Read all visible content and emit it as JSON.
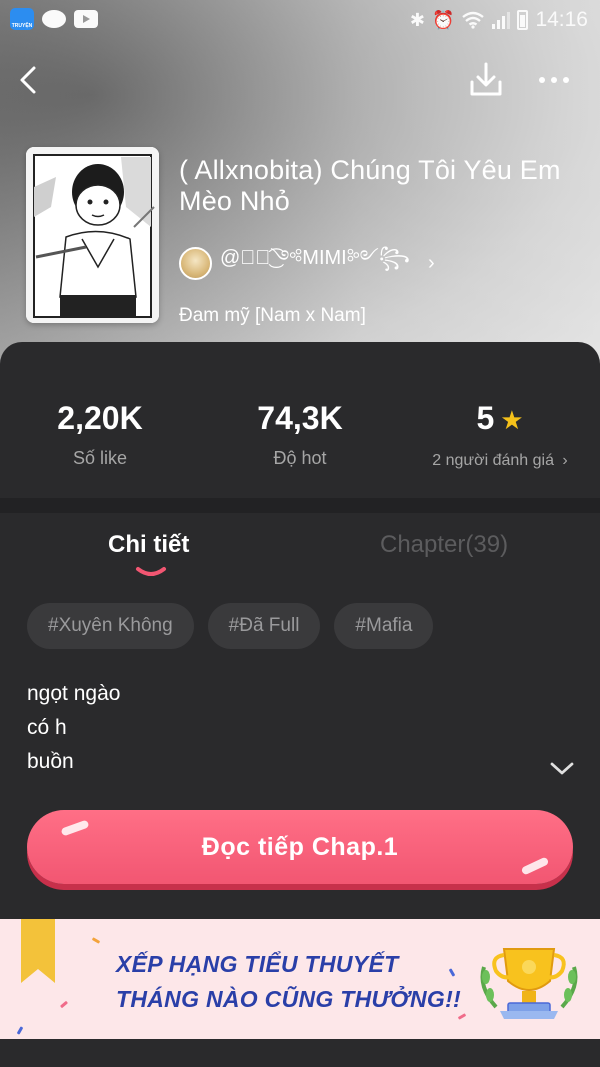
{
  "status_bar": {
    "time": "14:16",
    "app_icon_text": "TRUYỆN"
  },
  "story": {
    "title": "( Allxnobita) Chúng Tôi Yêu Em Mèo Nhỏ",
    "author": "@ꦿ⃟͜͡༺MIMI༻꧂",
    "genre": "Đam mỹ [Nam x Nam]"
  },
  "stats": {
    "likes": {
      "value": "2,20K",
      "label": "Số like"
    },
    "hot": {
      "value": "74,3K",
      "label": "Độ hot"
    },
    "rating": {
      "value": "5",
      "label": "2 người đánh giá"
    }
  },
  "tabs": {
    "detail": "Chi tiết",
    "chapters": "Chapter(39)"
  },
  "tags": [
    "#Xuyên Không",
    "#Đã Full",
    "#Mafia"
  ],
  "description": [
    "ngọt ngào",
    "có h",
    "buồn"
  ],
  "actions": {
    "read_label": "Đọc tiếp Chap.1"
  },
  "banner": {
    "line1": "XẾP HẠNG TIỂU THUYẾT",
    "line2": "THÁNG NÀO CŨNG THƯỞNG!!"
  },
  "colors": {
    "accent": "#f25672",
    "panel": "#2a2a2c",
    "star": "#f5c11a",
    "banner_text": "#2a3fa8"
  },
  "icons": [
    "back-icon",
    "download-icon",
    "more-icon",
    "star-icon",
    "chevron-right-icon",
    "chevron-down-icon",
    "trophy-icon",
    "bookmark-icon"
  ]
}
